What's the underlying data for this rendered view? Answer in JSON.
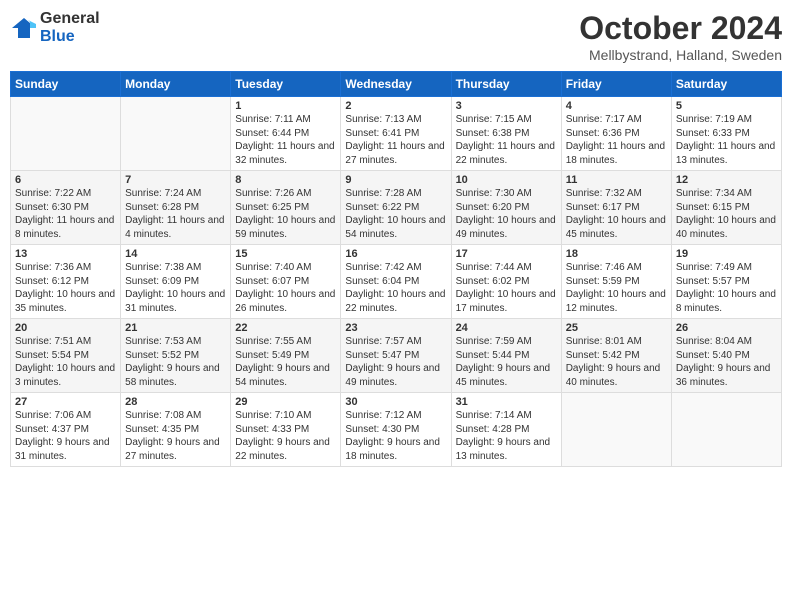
{
  "logo": {
    "general": "General",
    "blue": "Blue"
  },
  "title": "October 2024",
  "location": "Mellbystrand, Halland, Sweden",
  "days_of_week": [
    "Sunday",
    "Monday",
    "Tuesday",
    "Wednesday",
    "Thursday",
    "Friday",
    "Saturday"
  ],
  "weeks": [
    [
      {
        "day": "",
        "info": ""
      },
      {
        "day": "",
        "info": ""
      },
      {
        "day": "1",
        "info": "Sunrise: 7:11 AM\nSunset: 6:44 PM\nDaylight: 11 hours and 32 minutes."
      },
      {
        "day": "2",
        "info": "Sunrise: 7:13 AM\nSunset: 6:41 PM\nDaylight: 11 hours and 27 minutes."
      },
      {
        "day": "3",
        "info": "Sunrise: 7:15 AM\nSunset: 6:38 PM\nDaylight: 11 hours and 22 minutes."
      },
      {
        "day": "4",
        "info": "Sunrise: 7:17 AM\nSunset: 6:36 PM\nDaylight: 11 hours and 18 minutes."
      },
      {
        "day": "5",
        "info": "Sunrise: 7:19 AM\nSunset: 6:33 PM\nDaylight: 11 hours and 13 minutes."
      }
    ],
    [
      {
        "day": "6",
        "info": "Sunrise: 7:22 AM\nSunset: 6:30 PM\nDaylight: 11 hours and 8 minutes."
      },
      {
        "day": "7",
        "info": "Sunrise: 7:24 AM\nSunset: 6:28 PM\nDaylight: 11 hours and 4 minutes."
      },
      {
        "day": "8",
        "info": "Sunrise: 7:26 AM\nSunset: 6:25 PM\nDaylight: 10 hours and 59 minutes."
      },
      {
        "day": "9",
        "info": "Sunrise: 7:28 AM\nSunset: 6:22 PM\nDaylight: 10 hours and 54 minutes."
      },
      {
        "day": "10",
        "info": "Sunrise: 7:30 AM\nSunset: 6:20 PM\nDaylight: 10 hours and 49 minutes."
      },
      {
        "day": "11",
        "info": "Sunrise: 7:32 AM\nSunset: 6:17 PM\nDaylight: 10 hours and 45 minutes."
      },
      {
        "day": "12",
        "info": "Sunrise: 7:34 AM\nSunset: 6:15 PM\nDaylight: 10 hours and 40 minutes."
      }
    ],
    [
      {
        "day": "13",
        "info": "Sunrise: 7:36 AM\nSunset: 6:12 PM\nDaylight: 10 hours and 35 minutes."
      },
      {
        "day": "14",
        "info": "Sunrise: 7:38 AM\nSunset: 6:09 PM\nDaylight: 10 hours and 31 minutes."
      },
      {
        "day": "15",
        "info": "Sunrise: 7:40 AM\nSunset: 6:07 PM\nDaylight: 10 hours and 26 minutes."
      },
      {
        "day": "16",
        "info": "Sunrise: 7:42 AM\nSunset: 6:04 PM\nDaylight: 10 hours and 22 minutes."
      },
      {
        "day": "17",
        "info": "Sunrise: 7:44 AM\nSunset: 6:02 PM\nDaylight: 10 hours and 17 minutes."
      },
      {
        "day": "18",
        "info": "Sunrise: 7:46 AM\nSunset: 5:59 PM\nDaylight: 10 hours and 12 minutes."
      },
      {
        "day": "19",
        "info": "Sunrise: 7:49 AM\nSunset: 5:57 PM\nDaylight: 10 hours and 8 minutes."
      }
    ],
    [
      {
        "day": "20",
        "info": "Sunrise: 7:51 AM\nSunset: 5:54 PM\nDaylight: 10 hours and 3 minutes."
      },
      {
        "day": "21",
        "info": "Sunrise: 7:53 AM\nSunset: 5:52 PM\nDaylight: 9 hours and 58 minutes."
      },
      {
        "day": "22",
        "info": "Sunrise: 7:55 AM\nSunset: 5:49 PM\nDaylight: 9 hours and 54 minutes."
      },
      {
        "day": "23",
        "info": "Sunrise: 7:57 AM\nSunset: 5:47 PM\nDaylight: 9 hours and 49 minutes."
      },
      {
        "day": "24",
        "info": "Sunrise: 7:59 AM\nSunset: 5:44 PM\nDaylight: 9 hours and 45 minutes."
      },
      {
        "day": "25",
        "info": "Sunrise: 8:01 AM\nSunset: 5:42 PM\nDaylight: 9 hours and 40 minutes."
      },
      {
        "day": "26",
        "info": "Sunrise: 8:04 AM\nSunset: 5:40 PM\nDaylight: 9 hours and 36 minutes."
      }
    ],
    [
      {
        "day": "27",
        "info": "Sunrise: 7:06 AM\nSunset: 4:37 PM\nDaylight: 9 hours and 31 minutes."
      },
      {
        "day": "28",
        "info": "Sunrise: 7:08 AM\nSunset: 4:35 PM\nDaylight: 9 hours and 27 minutes."
      },
      {
        "day": "29",
        "info": "Sunrise: 7:10 AM\nSunset: 4:33 PM\nDaylight: 9 hours and 22 minutes."
      },
      {
        "day": "30",
        "info": "Sunrise: 7:12 AM\nSunset: 4:30 PM\nDaylight: 9 hours and 18 minutes."
      },
      {
        "day": "31",
        "info": "Sunrise: 7:14 AM\nSunset: 4:28 PM\nDaylight: 9 hours and 13 minutes."
      },
      {
        "day": "",
        "info": ""
      },
      {
        "day": "",
        "info": ""
      }
    ]
  ]
}
